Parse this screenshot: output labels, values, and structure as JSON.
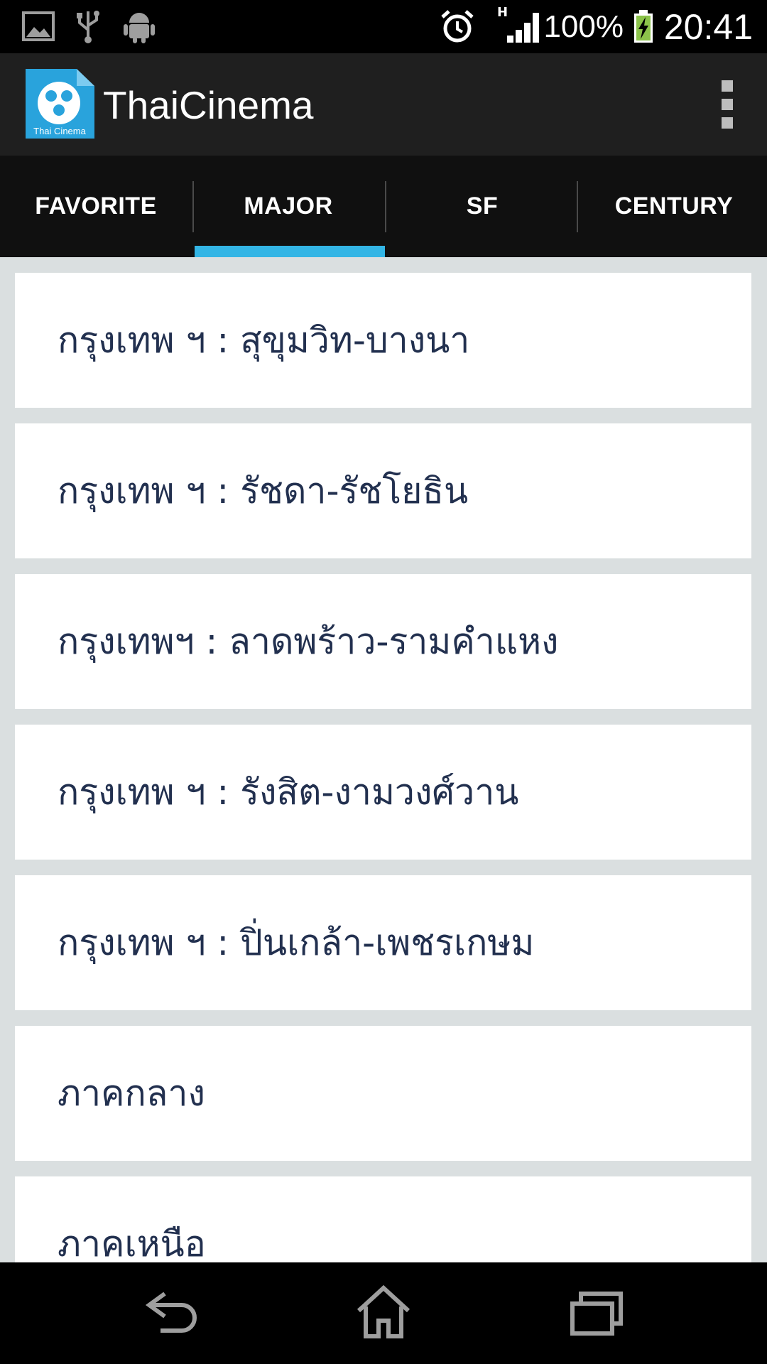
{
  "status_bar": {
    "battery": "100%",
    "time": "20:41",
    "signal_type": "H"
  },
  "app": {
    "title": "ThaiCinema",
    "logo_caption": "Thai Cinema"
  },
  "tabs": [
    {
      "label": "FAVORITE",
      "selected": false
    },
    {
      "label": "MAJOR",
      "selected": true
    },
    {
      "label": "SF",
      "selected": false
    },
    {
      "label": "CENTURY",
      "selected": false
    }
  ],
  "list": [
    {
      "label": "กรุงเทพ ฯ : สุขุมวิท-บางนา"
    },
    {
      "label": "กรุงเทพ ฯ : รัชดา-รัชโยธิน"
    },
    {
      "label": "กรุงเทพฯ : ลาดพร้าว-รามคำแหง"
    },
    {
      "label": "กรุงเทพ ฯ : รังสิต-งามวงศ์วาน"
    },
    {
      "label": "กรุงเทพ ฯ : ปิ่นเกล้า-เพชรเกษม"
    },
    {
      "label": "ภาคกลาง"
    },
    {
      "label": "ภาคเหนือ"
    }
  ],
  "colors": {
    "accent": "#33b5e5",
    "list_text": "#22304f",
    "background": "#dadfe0"
  },
  "icons": {
    "status": [
      "image-icon",
      "usb-icon",
      "android-icon",
      "alarm-icon",
      "signal-icon",
      "battery-charging-icon"
    ],
    "nav": [
      "back-icon",
      "home-icon",
      "recent-apps-icon"
    ],
    "menu": "overflow-menu-icon"
  }
}
